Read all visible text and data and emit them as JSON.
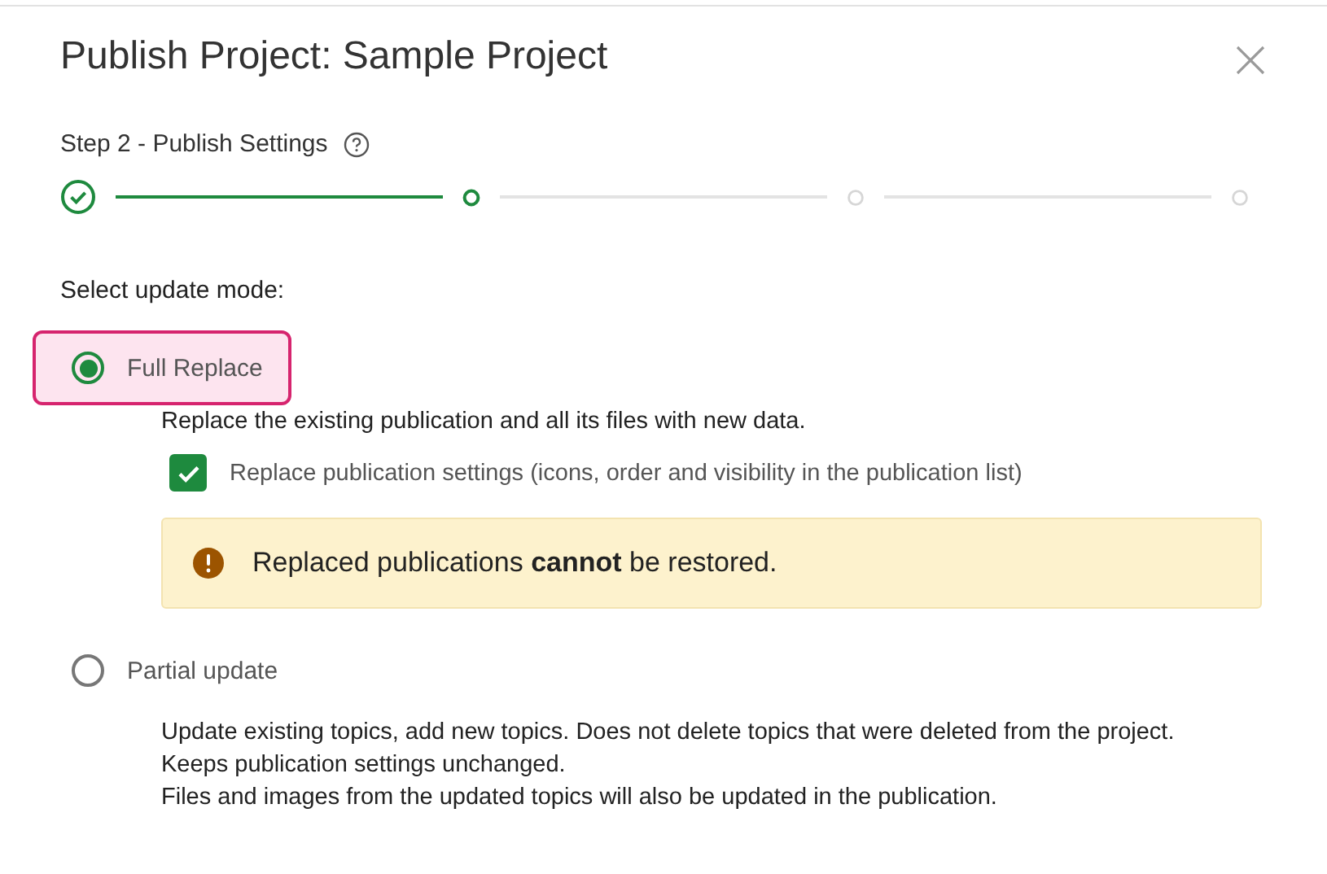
{
  "dialog": {
    "title": "Publish Project: Sample Project",
    "step_label": "Step 2 - Publish Settings"
  },
  "stepper": {
    "steps": [
      {
        "done": true,
        "selected": false
      },
      {
        "done": false,
        "selected": true
      },
      {
        "done": false,
        "selected": false
      },
      {
        "done": false,
        "selected": false
      }
    ]
  },
  "mode_prompt": "Select update mode:",
  "options": [
    {
      "label": "Full Replace",
      "selected": true,
      "focused": true,
      "description": [
        "Replace the existing publication and all its files with new data."
      ],
      "checkbox": {
        "label": "Replace publication settings (icons, order and visibility in the publication list)",
        "checked": true
      },
      "warning": "Replaced publications **cannot** be restored."
    },
    {
      "label": "Partial update",
      "selected": false,
      "focused": false,
      "description": [
        "Update existing topics, add new topics. Does not delete topics that were deleted from the project.",
        "Keeps publication settings unchanged.",
        "Files and images from the updated topics will also be updated in the publication."
      ]
    }
  ]
}
